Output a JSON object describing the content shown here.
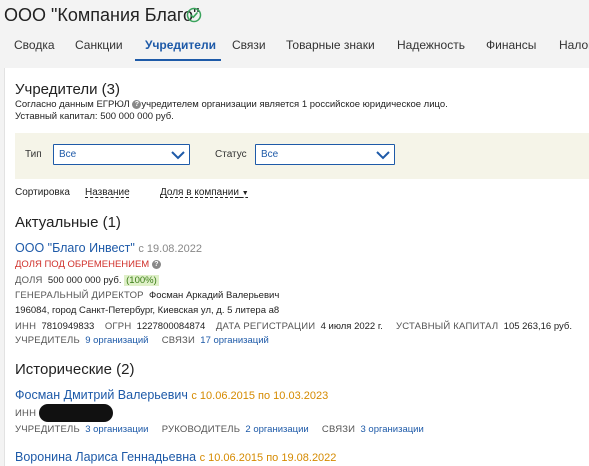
{
  "header": {
    "company_name": "ООО \"Компания Благо\""
  },
  "tabs": [
    {
      "label": "Сводка"
    },
    {
      "label": "Санкции"
    },
    {
      "label": "Учредители"
    },
    {
      "label": "Связи"
    },
    {
      "label": "Товарные знаки"
    },
    {
      "label": "Надежность"
    },
    {
      "label": "Финансы"
    },
    {
      "label": "Налоги"
    }
  ],
  "founders": {
    "title": "Учредители (3)",
    "egrul_prefix": "Согласно данным ЕГРЮЛ",
    "egrul_suffix": "учредителем организации является 1 российское юридическое лицо.",
    "capital": "Уставный капитал: 500 000 000 руб."
  },
  "filters": {
    "type_label": "Тип",
    "type_value": "Все",
    "status_label": "Статус",
    "status_value": "Все"
  },
  "sort": {
    "label": "Сортировка",
    "by_name": "Название",
    "by_share": "Доля в компании"
  },
  "current": {
    "title": "Актуальные (1)",
    "item": {
      "name": "ООО \"Благо Инвест\"",
      "since": "с 19.08.2022",
      "encumbrance": "ДОЛЯ ПОД ОБРЕМЕНЕНИЕМ",
      "share_label": "ДОЛЯ",
      "share_value": "500 000 000 руб.",
      "share_percent": "(100%)",
      "director_label": "ГЕНЕРАЛЬНЫЙ ДИРЕКТОР",
      "director_name": "Фосман Аркадий Валерьевич",
      "address": "196084, город Санкт-Петербург, Киевская ул, д. 5 литера а8",
      "inn_label": "ИНН",
      "inn_value": "7810949833",
      "ogrn_label": "ОГРН",
      "ogrn_value": "1227800084874",
      "reg_label": "ДАТА РЕГИСТРАЦИИ",
      "reg_value": "4 июля 2022 г.",
      "capital_label": "УСТАВНЫЙ КАПИТАЛ",
      "capital_value": "105 263,16 руб.",
      "founder_label": "УЧРЕДИТЕЛЬ",
      "founder_link": "9 организаций",
      "links_label": "СВЯЗИ",
      "links_link": "17 организаций"
    }
  },
  "historical": {
    "title": "Исторические (2)",
    "items": [
      {
        "name": "Фосман Дмитрий Валерьевич",
        "period": "с 10.06.2015 по 10.03.2023",
        "inn_label": "ИНН",
        "founder_label": "УЧРЕДИТЕЛЬ",
        "founder_link": "3 организации",
        "head_label": "РУКОВОДИТЕЛЬ",
        "head_link": "2 организации",
        "links_label": "СВЯЗИ",
        "links_link": "3 организации"
      },
      {
        "name": "Воронина Лариса Геннадьевна",
        "period": "с 10.06.2015 по 19.08.2022"
      }
    ]
  },
  "colors": {
    "accent": "#1e5aa8",
    "encumbrance": "#d0302b",
    "period": "#d58a00",
    "check": "#3aa35c",
    "filter_bg": "#f5f4e8"
  }
}
